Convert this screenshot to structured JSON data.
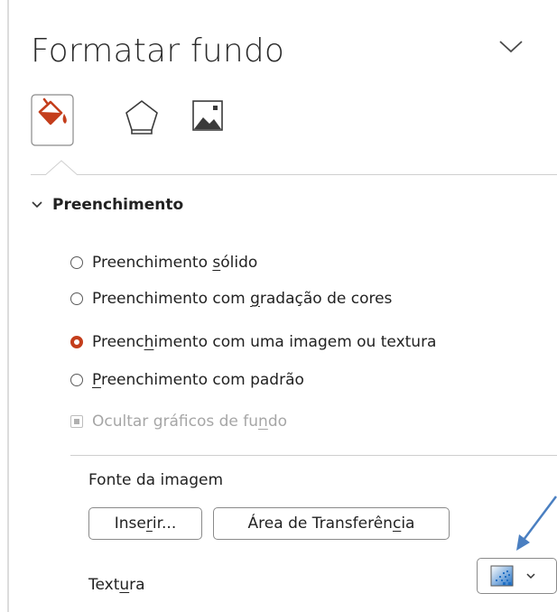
{
  "panel": {
    "title": "Formatar fundo"
  },
  "icons": {
    "collapse": "chevron-down-icon",
    "fill_tab": "paint-bucket-icon",
    "shape_tab": "pentagon-icon",
    "image_tab": "picture-icon"
  },
  "section": {
    "title": "Preenchimento",
    "options": [
      {
        "pre": "Preenchimento ",
        "key": "s",
        "post": "ólido",
        "checked": false
      },
      {
        "pre": "Preenchimento com ",
        "key": "g",
        "post": "radação de cores",
        "checked": false
      },
      {
        "pre": "Preenc",
        "key": "h",
        "post": "imento com uma imagem ou textura",
        "checked": true
      },
      {
        "pre": "",
        "key": "P",
        "post": "reenchimento com padrão",
        "checked": false
      }
    ],
    "hide_bg": {
      "pre": "Ocultar gráficos de fu",
      "key": "n",
      "post": "do",
      "enabled": false
    }
  },
  "image_source": {
    "label": "Fonte da imagem",
    "insert": {
      "pre": "Inse",
      "key": "r",
      "post": "ir..."
    },
    "clipboard": {
      "pre": "Área de Transferên",
      "key": "c",
      "post": "ia"
    }
  },
  "texture": {
    "label_pre": "Text",
    "label_key": "u",
    "label_post": "ra"
  },
  "colors": {
    "accent": "#c43e1c",
    "annotation_arrow": "#4a7fc1"
  }
}
